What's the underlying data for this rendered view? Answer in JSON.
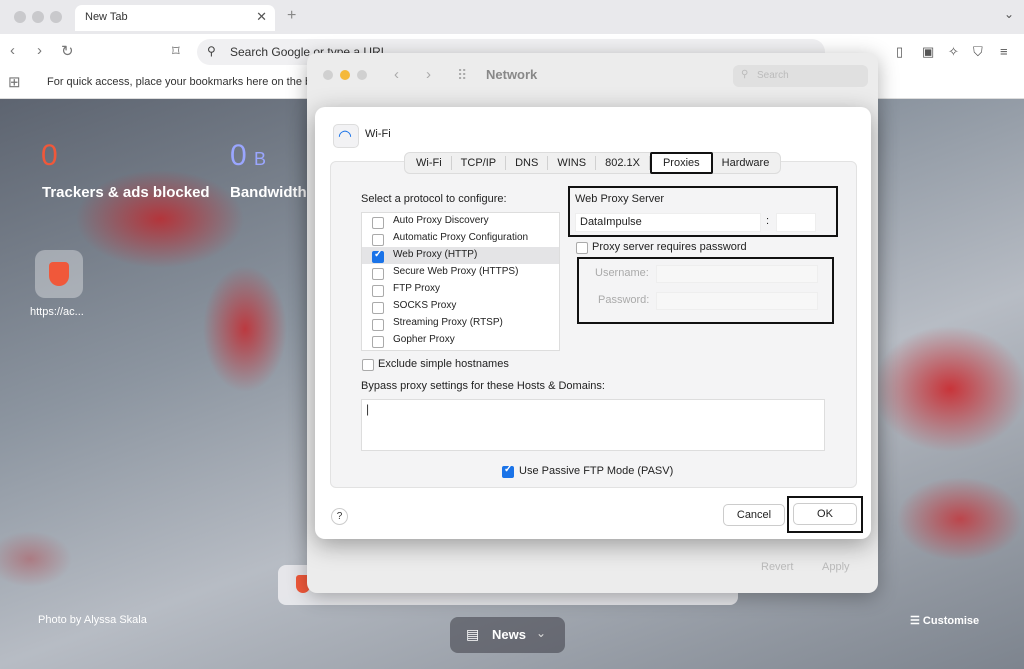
{
  "browser": {
    "tab_title": "New Tab",
    "url_placeholder": "Search Google or type a URL",
    "bookmarks_hint": "For quick access, place your bookmarks here on the b"
  },
  "ntp": {
    "trackers_count": "0",
    "trackers_label": "Trackers & ads blocked",
    "bandwidth_count": "0",
    "bandwidth_unit": "B",
    "bandwidth_label": "Bandwidth",
    "tile_label": "https://ac...",
    "photo_credit": "Photo by Alyssa Skala",
    "customise_label": "Customise",
    "news_label": "News",
    "accent_orange": "#f0583a",
    "accent_blue": "#9aa6ff"
  },
  "network_window": {
    "title": "Network",
    "search_placeholder": "Search",
    "revert_label": "Revert",
    "apply_label": "Apply"
  },
  "proxies_sheet": {
    "interface_name": "Wi-Fi",
    "tabs": [
      "Wi-Fi",
      "TCP/IP",
      "DNS",
      "WINS",
      "802.1X",
      "Proxies",
      "Hardware"
    ],
    "active_tab": "Proxies",
    "protocol_heading": "Select a protocol to configure:",
    "protocols": [
      {
        "label": "Auto Proxy Discovery",
        "checked": false
      },
      {
        "label": "Automatic Proxy Configuration",
        "checked": false
      },
      {
        "label": "Web Proxy (HTTP)",
        "checked": true
      },
      {
        "label": "Secure Web Proxy (HTTPS)",
        "checked": false
      },
      {
        "label": "FTP Proxy",
        "checked": false
      },
      {
        "label": "SOCKS Proxy",
        "checked": false
      },
      {
        "label": "Streaming Proxy (RTSP)",
        "checked": false
      },
      {
        "label": "Gopher Proxy",
        "checked": false
      }
    ],
    "server_heading": "Web Proxy Server",
    "server_value": "DataImpulse",
    "port_separator": ":",
    "requires_password_label": "Proxy server requires password",
    "username_label": "Username:",
    "password_label": "Password:",
    "exclude_simple_label": "Exclude simple hostnames",
    "bypass_label": "Bypass proxy settings for these Hosts & Domains:",
    "passive_ftp_label": "Use Passive FTP Mode (PASV)",
    "help_label": "?",
    "cancel_label": "Cancel",
    "ok_label": "OK"
  }
}
